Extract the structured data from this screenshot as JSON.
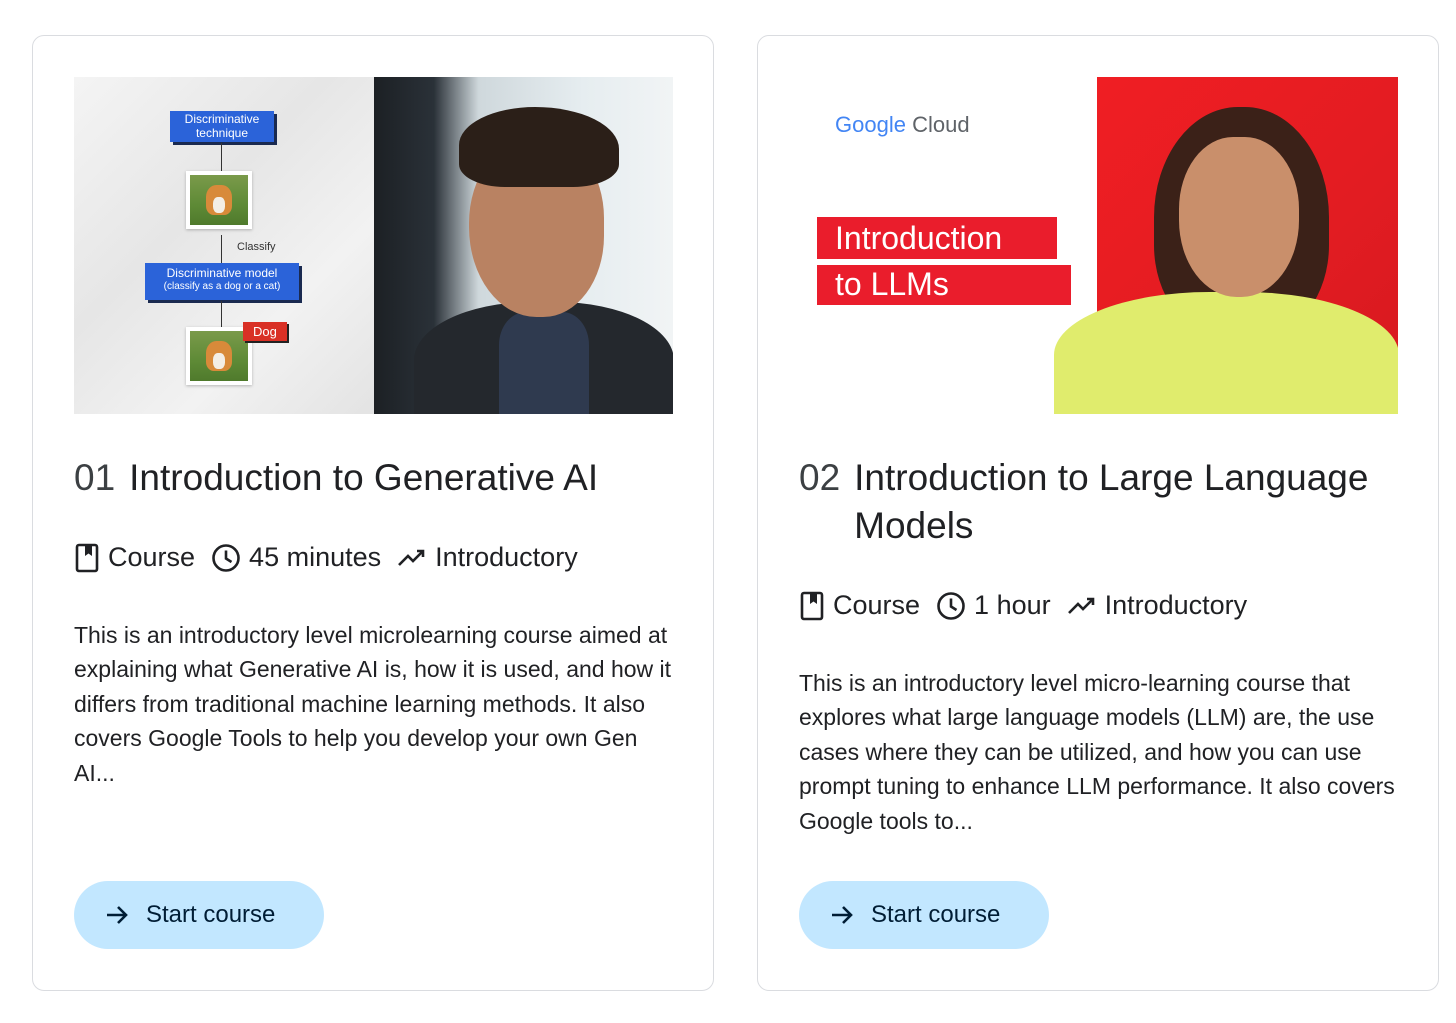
{
  "cards": [
    {
      "number": "01",
      "title": "Introduction to Generative AI",
      "type": "Course",
      "duration": "45 minutes",
      "level": "Introductory",
      "description": "This is an introductory level microlearning course aimed at explaining what Generative AI is, how it is used, and how it differs from traditional machine learning methods. It also covers Google Tools to help you develop your own Gen AI...",
      "button_label": "Start course",
      "thumbnail": {
        "box1": "Discriminative technique",
        "classify": "Classify",
        "box2_line1": "Discriminative model",
        "box2_line2": "(classify as a dog or a cat)",
        "tag": "Dog"
      }
    },
    {
      "number": "02",
      "title": "Introduction to Large Language Models",
      "type": "Course",
      "duration": "1 hour",
      "level": "Introductory",
      "description": "This is an introductory level micro-learning course that explores what large language models (LLM) are, the use cases where they can be utilized, and how you can use prompt tuning to enhance LLM performance. It also covers Google tools to...",
      "button_label": "Start course",
      "thumbnail": {
        "brand_google": "Google",
        "brand_cloud": "Cloud",
        "band1": "Introduction",
        "band2": "to LLMs"
      }
    }
  ],
  "icons": {
    "type": "bookmark-icon",
    "duration": "clock-icon",
    "level": "trending-icon",
    "button": "arrow-right-icon"
  },
  "colors": {
    "button_bg": "#c2e7ff",
    "card_border": "#dadce0",
    "band_red": "#ea1d2c"
  }
}
